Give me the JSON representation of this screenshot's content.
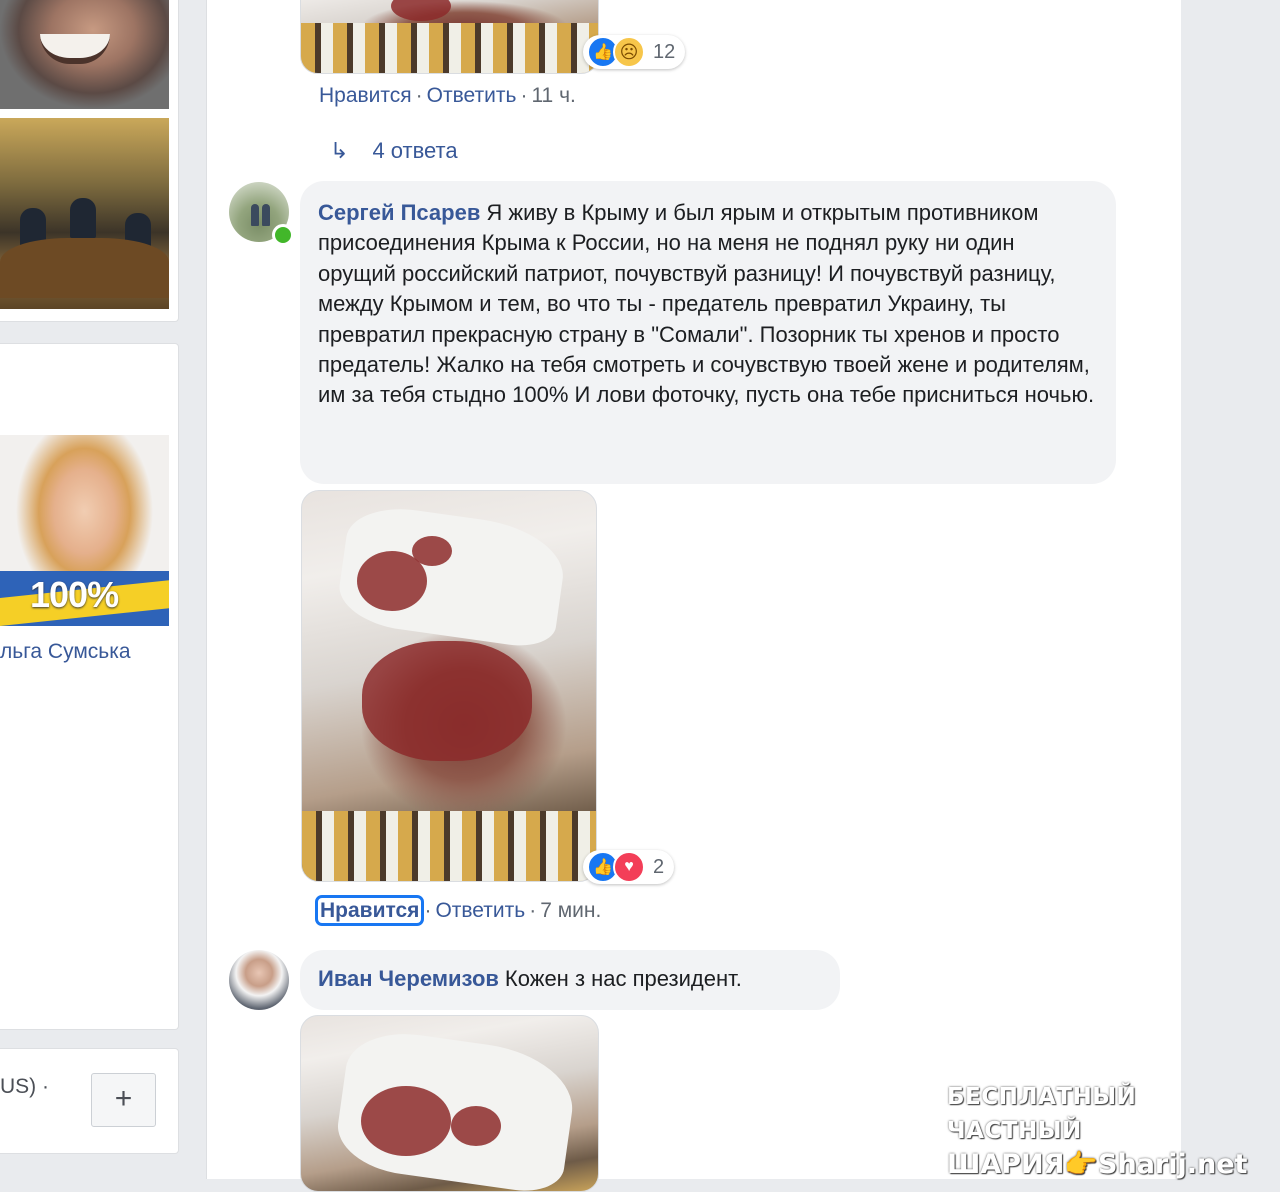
{
  "sidebar": {
    "profile_name": "льга Сумська",
    "photo_label": "100%",
    "language_text": "US) ·",
    "add_button": "+"
  },
  "comments": [
    {
      "reactions_count": "12",
      "like_label": "Нравится",
      "reply_label": "Ответить",
      "time": "11 ч."
    },
    {
      "author": "Сергей Псарев",
      "text": "Я живу в Крыму и был ярым и открытым противником присоединения Крыма к России, но на меня не поднял руку ни один орущий российский патриот, почувствуй разницу! И почувствуй разницу, между Крымом и тем, во что ты - предатель превратил Украину, ты превратил прекрасную страну в \"Сомали\". Позорник ты хренов и просто предатель! Жалко на тебя смотреть и сочувствую твоей жене и родителям, им за тебя стыдно 100% И лови фоточку, пусть она тебе присниться ночью.",
      "reactions_count": "2",
      "like_label": "Нравится",
      "reply_label": "Ответить",
      "time": "7 мин."
    },
    {
      "author": "Иван Черемизов",
      "text": "Кожен з нас президент."
    }
  ],
  "replies_link": "4 ответа",
  "separator": "·",
  "icons": {
    "like": "like-icon",
    "sad": "sad-icon",
    "love": "love-icon",
    "reply_arrow": "reply-arrow-icon",
    "plus": "plus-icon"
  },
  "colors": {
    "link": "#385898",
    "bubble": "#f2f3f5",
    "like": "#1877f2",
    "online": "#42b72a"
  },
  "watermark": {
    "line1": "БЕСПЛАТНЫЙ ЧАСТНЫЙ",
    "line2": "ШАРИЯ👉Sharij.net"
  }
}
